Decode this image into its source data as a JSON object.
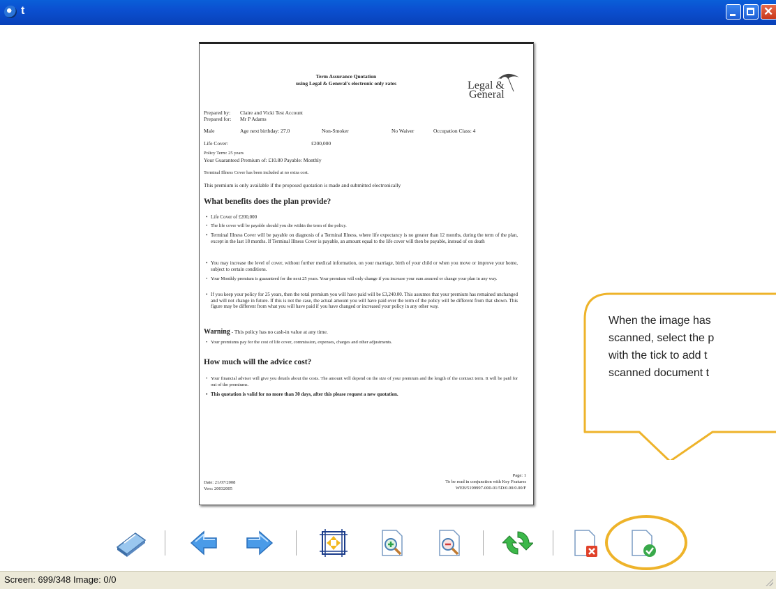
{
  "window": {
    "title": "t",
    "buttons": {
      "minimize": "minimize",
      "maximize": "maximize",
      "close": "close"
    }
  },
  "document": {
    "title_line1": "Term Assurance Quotation",
    "title_line2": "using Legal & General's electronic only rates",
    "logo_line1": "Legal &",
    "logo_line2": "General",
    "prepared_by_label": "Prepared by:",
    "prepared_by_value": "Claire and Vicki Test Account",
    "prepared_for_label": "Prepared for:",
    "prepared_for_value": "Mr P Adams",
    "row_sex": "Male",
    "row_age": "Age next birthday: 27.0",
    "row_smoker": "Non-Smoker",
    "row_waiver": "No Waiver",
    "row_occupation": "Occupation Class: 4",
    "life_cover_label": "Life Cover:",
    "life_cover_value": "£200,000",
    "policy_term": "Policy Term: 25 years",
    "premium": "Your Guaranteed Premium of: £10.80 Payable: Monthly",
    "terminal_note": "Terminal Illness Cover has been included at no extra cost.",
    "premium_note": "This premium is only available if the proposed quotation is made and submitted electronically",
    "heading_benefits": "What benefits does the plan provide?",
    "bullets_benefits": [
      "Life Cover of £200,000",
      "The life cover will be payable should you die within the term of the policy.",
      "Terminal Illness Cover will be payable on diagnosis of a Terminal Illness, where life expectancy is no greater than 12 months, during the term of the plan, except in the last 18 months. If Terminal Illness Cover is payable, an amount equal to the life cover will then be payable, instead of on death",
      "You may increase the level of cover, without further medical information, on your marriage, birth of your child or when you move or improve your home, subject to certain conditions.",
      "Your Monthly premium is guaranteed for the next 25 years. Your premium will only change if you increase your sum assured or change your plan in any way.",
      "If you keep your policy for 25 years, then the total premium you will have paid will be £3,240.00. This assumes that your premium has remained unchanged and will not change in future. If this is not the case, the actual amount you will have paid over the term of the policy will be different from that shown. This figure may be different from what you will have paid if you have changed or increased your policy in any other way."
    ],
    "warning_heading": "Warning",
    "warning_text": " - This policy has no cash-in value at any time.",
    "bullets_warning": [
      "Your premiums pay for the cost of life cover, commission, expenses, charges and other adjustments."
    ],
    "heading_advice": "How much will the advice cost?",
    "bullets_advice": [
      "Your financial adviser will give you details about the costs. The amount will depend on the size of your premium and the length of the contract term. It will be paid for out of the premiums.",
      "This quotation is valid for no more than 30 days, after this please request a new quotation."
    ],
    "footer_date": "Date: 21/07/2008",
    "footer_vers": "Vers: 20032005",
    "footer_page": "Page: 1",
    "footer_note": "To be read in conjunction with Key Features",
    "footer_ref": "WEB/5199997-000-01/5D/0.00/0.00/F"
  },
  "callout": {
    "lines": [
      "When the image has",
      "scanned, select the p",
      "with the tick to add t",
      "scanned document t"
    ],
    "color": "#eeb32a"
  },
  "toolbar": {
    "tools": [
      {
        "name": "scanner-icon"
      },
      {
        "name": "previous-arrow-icon"
      },
      {
        "name": "next-arrow-icon"
      },
      {
        "name": "fit-to-page-icon"
      },
      {
        "name": "zoom-in-icon"
      },
      {
        "name": "zoom-out-icon"
      },
      {
        "name": "rotate-icon"
      },
      {
        "name": "discard-page-icon"
      },
      {
        "name": "accept-page-icon"
      }
    ]
  },
  "status": {
    "text": "Screen: 699/348 Image: 0/0"
  }
}
